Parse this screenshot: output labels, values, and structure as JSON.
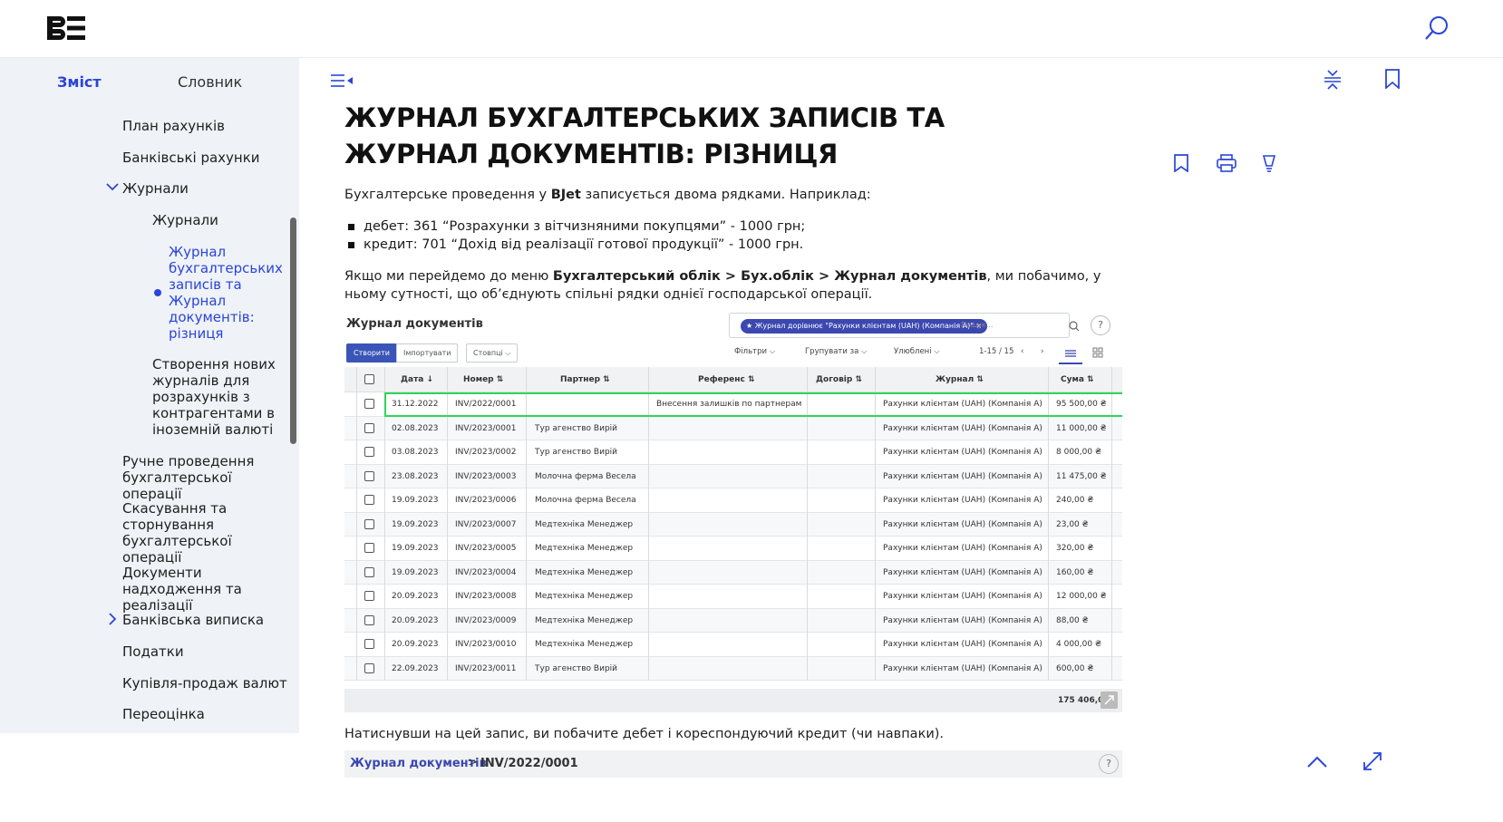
{
  "header": {
    "logo_text": "BE"
  },
  "sidebar": {
    "tabs": [
      "Зміст",
      "Словник"
    ],
    "items": [
      {
        "label": "План рахунків"
      },
      {
        "label": "Банківські рахунки"
      },
      {
        "label": "Журнали"
      },
      {
        "label": "Журнали"
      },
      {
        "label": "Журнал бухгалтерських записів та Журнал документів: різниця"
      },
      {
        "label": "Створення нових журналів для розрахунків з контрагентами в іноземній валюті"
      },
      {
        "label": "Ручне проведення бухгалтерської операції"
      },
      {
        "label": "Скасування та сторнування бухгалтерської операції"
      },
      {
        "label": "Документи надходження та реалізації"
      },
      {
        "label": "Банківська виписка"
      },
      {
        "label": "Податки"
      },
      {
        "label": "Купівля-продаж валют"
      },
      {
        "label": "Переоцінка"
      }
    ]
  },
  "article": {
    "title": "ЖУРНАЛ БУХГАЛТЕРСЬКИХ ЗАПИСІВ ТА ЖУРНАЛ ДОКУМЕНТІВ: РІЗНИЦЯ",
    "intro_pre": "Бухгалтерське проведення у ",
    "intro_bold": "BJet",
    "intro_post": " записується двома рядками. Наприклад:",
    "list": [
      "дебет: 361 “Розрахунки з вітчизняними покупцями” - 1000 грн;",
      "кредит: 701 “Дохід від реалізації готової продукції” - 1000 грн."
    ],
    "para2_pre": "Якщо ми перейдемо до меню ",
    "para2_bold": "Бухгалтерський облік > Бух.облік > Журнал документів",
    "para2_post": ", ми побачимо, у ньому сутності, що об’єднують спільні рядки однієї господарської операції.",
    "para3": "Натиснувши на цей запис, ви побачите дебет і кореспондуючий кредит (чи навпаки)."
  },
  "screenshot": {
    "title": "Журнал документів",
    "filter_chip": "★ Журнал дорівнює \"Рахунки клієнтам (UAH) (Компанія А)\" ×",
    "filter_placeholder": "Пошук...",
    "help": "?",
    "btn_create": "Створити",
    "btn_import": "Імпортувати",
    "btn_columns": "Стовпці ⌵",
    "filters": "Фільтри ⌵",
    "group_by": "Групувати за ⌵",
    "favorites": "Улюблені ⌵",
    "pager": "1-15 / 15",
    "columns": [
      "Дата ↓",
      "Номер ⇅",
      "Партнер ⇅",
      "Референс ⇅",
      "Договір ⇅",
      "Журнал ⇅",
      "Сума ⇅"
    ],
    "rows": [
      {
        "date": "31.12.2022",
        "number": "INV/2022/0001",
        "partner": "",
        "ref": "Внесення залишків по партнерам",
        "journal": "Рахунки клієнтам (UAH) (Компанія А)",
        "amount": "95 500,00 ₴"
      },
      {
        "date": "02.08.2023",
        "number": "INV/2023/0001",
        "partner": "Тур агенство Вирій",
        "ref": "",
        "journal": "Рахунки клієнтам (UAH) (Компанія А)",
        "amount": "11 000,00 ₴"
      },
      {
        "date": "03.08.2023",
        "number": "INV/2023/0002",
        "partner": "Тур агенство Вирій",
        "ref": "",
        "journal": "Рахунки клієнтам (UAH) (Компанія А)",
        "amount": "8 000,00 ₴"
      },
      {
        "date": "23.08.2023",
        "number": "INV/2023/0003",
        "partner": "Молочна ферма Весела",
        "ref": "",
        "journal": "Рахунки клієнтам (UAH) (Компанія А)",
        "amount": "11 475,00 ₴"
      },
      {
        "date": "19.09.2023",
        "number": "INV/2023/0006",
        "partner": "Молочна ферма Весела",
        "ref": "",
        "journal": "Рахунки клієнтам (UAH) (Компанія А)",
        "amount": "240,00 ₴"
      },
      {
        "date": "19.09.2023",
        "number": "INV/2023/0007",
        "partner": "Медтехніка Менеджер",
        "ref": "",
        "journal": "Рахунки клієнтам (UAH) (Компанія А)",
        "amount": "23,00 ₴"
      },
      {
        "date": "19.09.2023",
        "number": "INV/2023/0005",
        "partner": "Медтехніка Менеджер",
        "ref": "",
        "journal": "Рахунки клієнтам (UAH) (Компанія А)",
        "amount": "320,00 ₴"
      },
      {
        "date": "19.09.2023",
        "number": "INV/2023/0004",
        "partner": "Медтехніка Менеджер",
        "ref": "",
        "journal": "Рахунки клієнтам (UAH) (Компанія А)",
        "amount": "160,00 ₴"
      },
      {
        "date": "20.09.2023",
        "number": "INV/2023/0008",
        "partner": "Медтехніка Менеджер",
        "ref": "",
        "journal": "Рахунки клієнтам (UAH) (Компанія А)",
        "amount": "12 000,00 ₴"
      },
      {
        "date": "20.09.2023",
        "number": "INV/2023/0009",
        "partner": "Медтехніка Менеджер",
        "ref": "",
        "journal": "Рахунки клієнтам (UAH) (Компанія А)",
        "amount": "88,00 ₴"
      },
      {
        "date": "20.09.2023",
        "number": "INV/2023/0010",
        "partner": "Медтехніка Менеджер",
        "ref": "",
        "journal": "Рахунки клієнтам (UAH) (Компанія А)",
        "amount": "4 000,00 ₴"
      },
      {
        "date": "22.09.2023",
        "number": "INV/2023/0011",
        "partner": "Тур агенство Вирій",
        "ref": "",
        "journal": "Рахунки клієнтам (UAH) (Компанія А)",
        "amount": "600,00 ₴"
      }
    ],
    "total": "175 406,0("
  },
  "breadcrumb": {
    "link": "Журнал документів",
    "sep": ">",
    "current": "INV/2022/0001",
    "help": "?"
  },
  "colors": {
    "accent": "#2a45d8",
    "sidebar_bg": "#eff2f6",
    "highlight": "#2bd65c",
    "primary_btn": "#3b54b8"
  }
}
